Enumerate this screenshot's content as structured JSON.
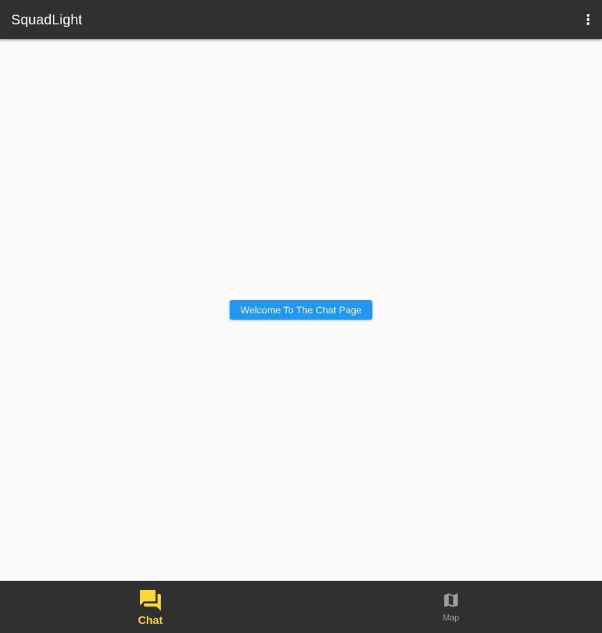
{
  "app_bar": {
    "title": "SquadLight",
    "menu_icon": "more-vert-icon",
    "background": "#303030"
  },
  "main": {
    "welcome_button_label": "Welcome To The Chat Page",
    "button_color": "#2196f3"
  },
  "bottom_nav": {
    "items": [
      {
        "label": "Chat",
        "icon": "forum-icon",
        "selected": true,
        "color": "#fdd835"
      },
      {
        "label": "Map",
        "icon": "map-icon",
        "selected": false,
        "color": "#9e9e9e"
      }
    ]
  }
}
